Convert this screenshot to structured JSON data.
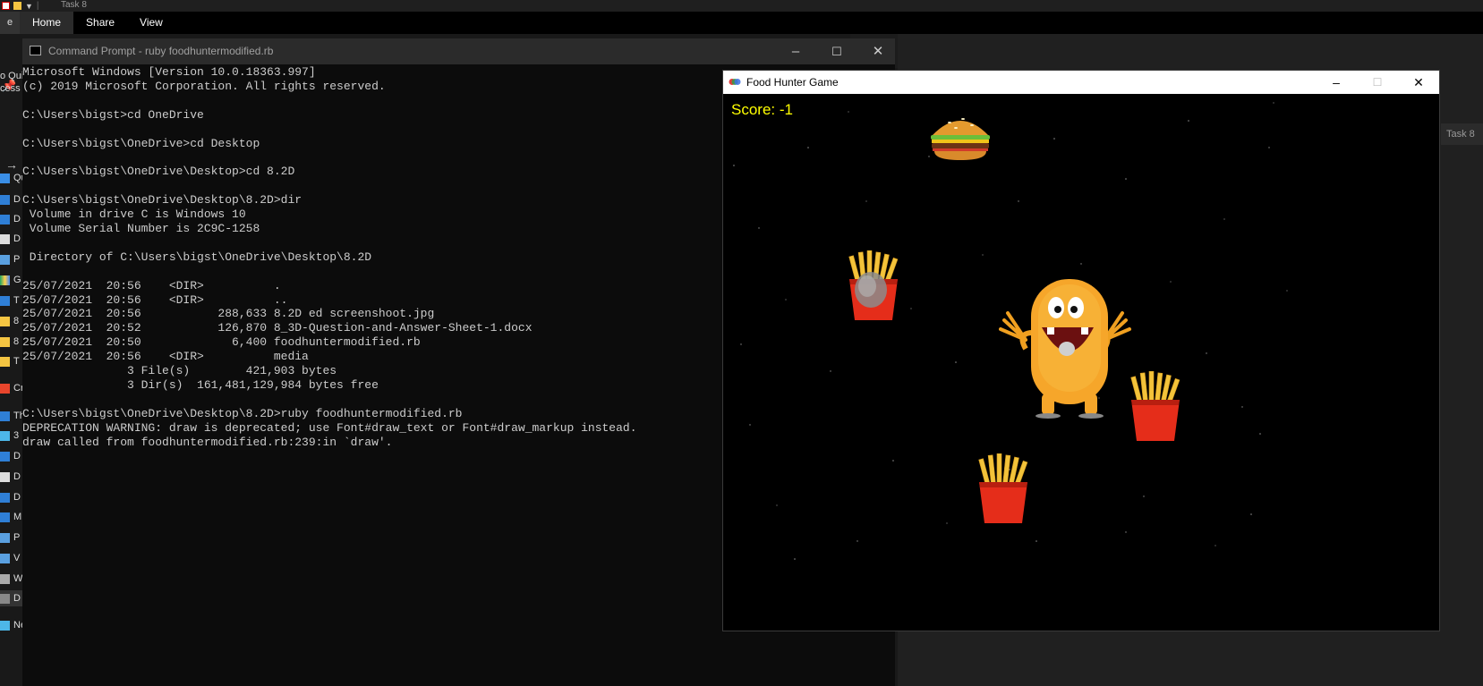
{
  "explorer": {
    "window_title": "Task 8",
    "file_tab": "e",
    "ribbon_tabs": [
      "Home",
      "Share",
      "View"
    ],
    "search_placeholder": "Task 8",
    "nav_fragments": [
      "o Qui",
      "cess",
      "Qu",
      "D",
      "D",
      "D",
      "P",
      "G",
      "T",
      "8",
      "8",
      "T",
      "Cre",
      "Thi",
      "3",
      "D",
      "D",
      "D",
      "M",
      "P",
      "V",
      "W",
      "D",
      "Ne"
    ]
  },
  "cmd": {
    "title": "Command Prompt - ruby  foodhuntermodified.rb",
    "output": "Microsoft Windows [Version 10.0.18363.997]\n(c) 2019 Microsoft Corporation. All rights reserved.\n\nC:\\Users\\bigst>cd OneDrive\n\nC:\\Users\\bigst\\OneDrive>cd Desktop\n\nC:\\Users\\bigst\\OneDrive\\Desktop>cd 8.2D\n\nC:\\Users\\bigst\\OneDrive\\Desktop\\8.2D>dir\n Volume in drive C is Windows 10\n Volume Serial Number is 2C9C-1258\n\n Directory of C:\\Users\\bigst\\OneDrive\\Desktop\\8.2D\n\n25/07/2021  20:56    <DIR>          .\n25/07/2021  20:56    <DIR>          ..\n25/07/2021  20:56           288,633 8.2D ed screenshoot.jpg\n25/07/2021  20:52           126,870 8_3D-Question-and-Answer-Sheet-1.docx\n25/07/2021  20:50             6,400 foodhuntermodified.rb\n25/07/2021  20:56    <DIR>          media\n               3 File(s)        421,903 bytes\n               3 Dir(s)  161,481,129,984 bytes free\n\nC:\\Users\\bigst\\OneDrive\\Desktop\\8.2D>ruby foodhuntermodified.rb\nDEPRECATION WARNING: draw is deprecated; use Font#draw_text or Font#draw_markup instead.\ndraw called from foodhuntermodified.rb:239:in `draw'."
  },
  "game": {
    "title": "Food Hunter Game",
    "score_text": "Score: -1",
    "sprites": [
      "burger-icon",
      "fries-icon",
      "monster-player",
      "fries-icon",
      "fries-icon"
    ]
  },
  "colors": {
    "score": "#ffff00",
    "console_text": "#cccccc",
    "console_bg": "#0c0c0c"
  }
}
